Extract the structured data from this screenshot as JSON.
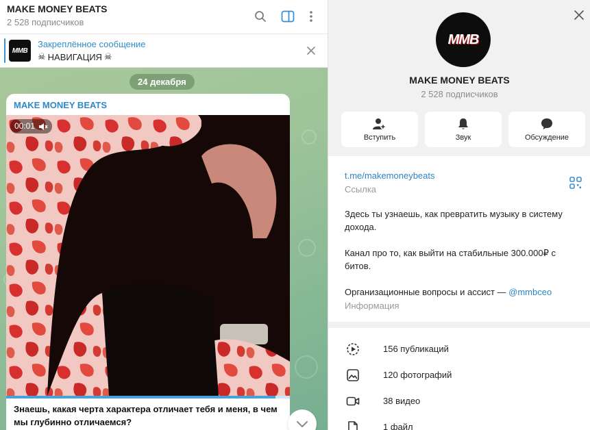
{
  "chat": {
    "title": "MAKE MONEY BEATS",
    "subscribers": "2 528 подписчиков",
    "header_icons": [
      "search-icon",
      "sidebar-toggle-icon",
      "more-icon"
    ],
    "pinned": {
      "title": "Закреплённое сообщение",
      "text": "НАВИГАЦИЯ",
      "thumb_logo": "MMB"
    },
    "date": "24 декабря",
    "message": {
      "author": "MAKE MONEY BEATS",
      "video_time": "00:01",
      "video_progress": 0.95,
      "caption": "Знаешь, какая черта характера отличает тебя и меня, в чем мы глубинно отличаемся?"
    }
  },
  "info": {
    "avatar_logo": "MMB",
    "name": "MAKE MONEY BEATS",
    "subscribers": "2 528 подписчиков",
    "actions": [
      {
        "label": "Вступить",
        "icon": "add-user-icon"
      },
      {
        "label": "Звук",
        "icon": "bell-icon"
      },
      {
        "label": "Обсуждение",
        "icon": "chat-icon"
      }
    ],
    "link": "t.me/makemoneybeats",
    "link_label": "Ссылка",
    "description": {
      "p1": "Здесь ты узнаешь, как превратить музыку в систему дохода.",
      "p2": "Канал про то, как выйти на стабильные 300.000₽ с битов.",
      "p3_text": "Организационные вопросы и ассист — ",
      "p3_mention": "@mmbceo"
    },
    "info_label": "Информация",
    "stats": [
      {
        "label": "156 публикаций",
        "icon": "publications-icon"
      },
      {
        "label": "120 фотографий",
        "icon": "photo-icon"
      },
      {
        "label": "38 видео",
        "icon": "video-icon"
      },
      {
        "label": "1 файл",
        "icon": "file-icon"
      }
    ]
  },
  "colors": {
    "accent": "#2b86c6",
    "wallpaper": "#9ec49a",
    "muted": "#8c8c8c"
  }
}
